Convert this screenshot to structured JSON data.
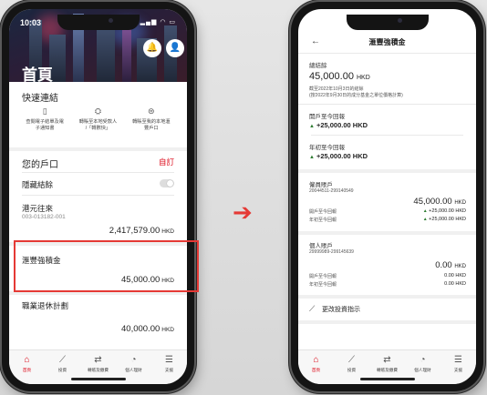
{
  "phone1": {
    "status_time": "10:03",
    "page_title": "首頁",
    "quick_links_title": "快速連結",
    "quick_links": [
      {
        "icon": "document-icon",
        "label_line1": "查閱電子結單及電",
        "label_line2": "子通知書"
      },
      {
        "icon": "transfer-person-icon",
        "label_line1": "轉賬至本地受款人",
        "label_line2": "/「轉數快」"
      },
      {
        "icon": "transfer-own-icon",
        "label_line1": "轉賬至我的本地滙",
        "label_line2": "豐戶口"
      }
    ],
    "accounts_title": "您的戶口",
    "customize_label": "自訂",
    "hide_balance_label": "隱藏結餘",
    "accounts": [
      {
        "name": "港元往來",
        "number": "003-013182-001",
        "amount": "2,417,579.00",
        "currency": "HKD"
      },
      {
        "name": "滙豐強積金",
        "number": "",
        "amount": "45,000.00",
        "currency": "HKD"
      },
      {
        "name": "職業退休計劃",
        "number": "",
        "amount": "40,000.00",
        "currency": "HKD"
      }
    ],
    "tabs": [
      {
        "label": "首頁",
        "icon": "home-icon"
      },
      {
        "label": "投資",
        "icon": "chart-icon"
      },
      {
        "label": "轉賬及繳費",
        "icon": "exchange-icon"
      },
      {
        "label": "個人理財",
        "icon": "pie-icon"
      },
      {
        "label": "支援",
        "icon": "chat-icon"
      }
    ]
  },
  "phone2": {
    "page_title": "滙豐強積金",
    "total_balance_label": "總結餘",
    "total_balance": "45,000.00",
    "currency": "HKD",
    "note_line1": "截至2022年10月3日的結餘",
    "note_line2": "(按2022年9月30日的成分基金之單位價格計算)",
    "since_open_label": "開戶至今回報",
    "since_open_value": "+25,000.00 HKD",
    "ytd_label": "年初至今回報",
    "ytd_value": "+25,000.00 HKD",
    "sub_accounts": [
      {
        "name": "僱員賬戶",
        "number": "20044511-299140549",
        "balance": "45,000.00",
        "currency": "HKD",
        "since_open_label": "開戶至今回報",
        "since_open_value": "+25,000.00 HKD",
        "ytd_label": "年初至今回報",
        "ytd_value": "+25,000.00 HKD"
      },
      {
        "name": "個人賬戶",
        "number": "29999989-299145639",
        "balance": "0.00",
        "currency": "HKD",
        "since_open_label": "開戶至今回報",
        "since_open_value": "0.00 HKD",
        "ytd_label": "年初至今回報",
        "ytd_value": "0.00 HKD"
      }
    ],
    "change_instruction": "更改投資指示",
    "tabs": [
      {
        "label": "首頁"
      },
      {
        "label": "投資"
      },
      {
        "label": "轉賬及繳費"
      },
      {
        "label": "個人理財"
      },
      {
        "label": "支援"
      }
    ]
  },
  "colors": {
    "brand_red": "#db0011",
    "highlight": "#e53935",
    "green_up": "#2e7d32"
  }
}
